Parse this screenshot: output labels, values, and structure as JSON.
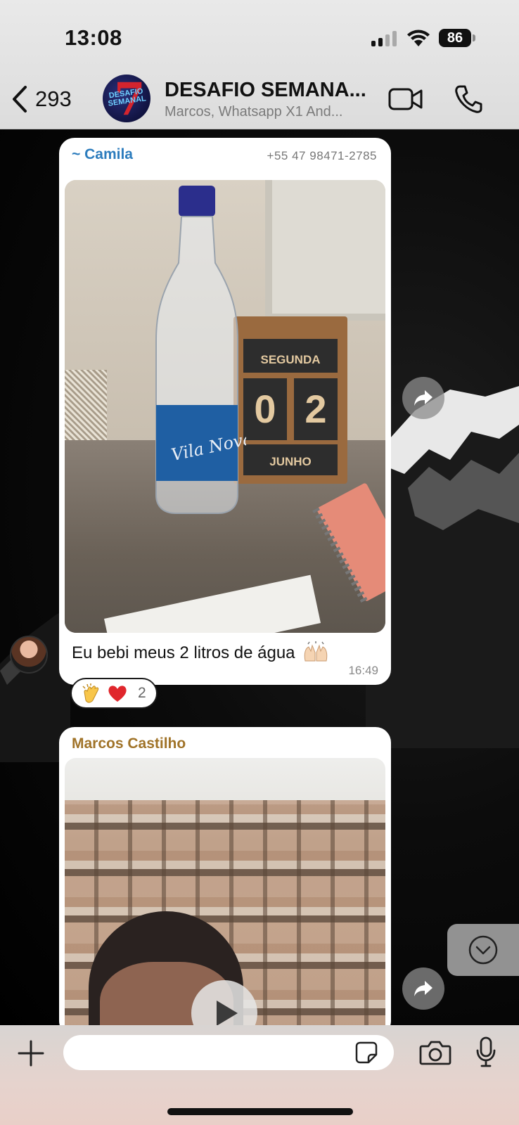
{
  "status_bar": {
    "time": "13:08",
    "battery": "86"
  },
  "header": {
    "back_count": "293",
    "title": "DESAFIO SEMANA...",
    "subtitle": "Marcos, Whatsapp X1 And...",
    "group_avatar_text": "DESAFIO SEMANAL",
    "group_avatar_number": "7"
  },
  "messages": [
    {
      "sender": "~ Camila",
      "phone": "+55 47 98471-2785",
      "photo_labels": {
        "day_name": "SEGUNDA",
        "day_digit_1": "0",
        "day_digit_2": "2",
        "month": "JUNHO",
        "bottle_brand": "Vila Nova"
      },
      "text": "Eu bebi meus 2 litros de água",
      "time": "16:49",
      "reactions": {
        "emojis": [
          "clapping-hands",
          "red-heart"
        ],
        "count": "2"
      }
    },
    {
      "sender": "Marcos Castilho",
      "type": "video"
    }
  ],
  "input": {
    "placeholder": ""
  },
  "colors": {
    "camila_name": "#2c7cbd",
    "marcos_name": "#a07328",
    "header_bg": "#e3e3e3",
    "bubble_bg": "#ffffff"
  }
}
